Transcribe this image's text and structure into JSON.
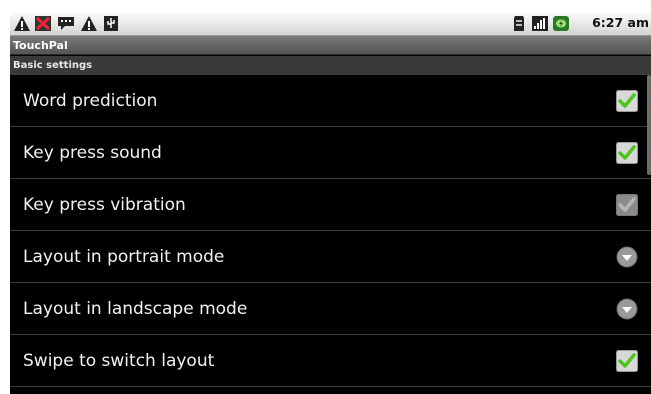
{
  "status_bar": {
    "time": "6:27 am",
    "left_icons": [
      "warning-icon",
      "image-error-icon",
      "chat-bubble-icon",
      "warning-icon",
      "usb-icon"
    ],
    "right_icons": [
      "sd-card-icon",
      "signal-icon",
      "battery-charging-icon"
    ]
  },
  "app_title": "TouchPal",
  "section": {
    "title": "Basic settings"
  },
  "settings": [
    {
      "label": "Word prediction",
      "widget": "checkbox",
      "checked": true,
      "enabled": true
    },
    {
      "label": "Key press sound",
      "widget": "checkbox",
      "checked": true,
      "enabled": true
    },
    {
      "label": "Key press vibration",
      "widget": "checkbox",
      "checked": true,
      "enabled": false
    },
    {
      "label": "Layout in portrait mode",
      "widget": "dropdown",
      "enabled": true
    },
    {
      "label": "Layout in landscape mode",
      "widget": "dropdown",
      "enabled": true
    },
    {
      "label": "Swipe to switch layout",
      "widget": "checkbox",
      "checked": true,
      "enabled": true
    }
  ],
  "colors": {
    "check_green": "#4cc61c",
    "background": "#000000",
    "title_bar": "#5e5e5e"
  }
}
